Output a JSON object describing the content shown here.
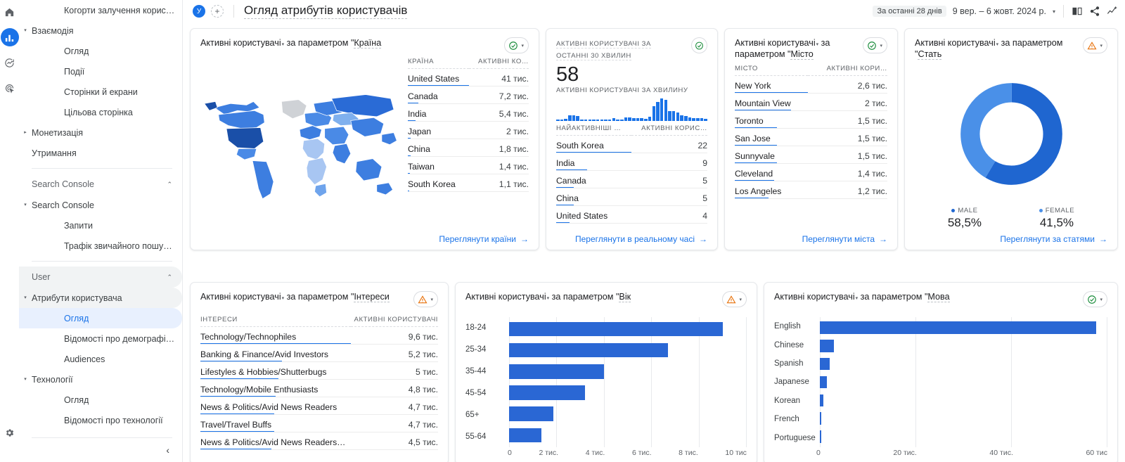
{
  "rail": {
    "items": [
      {
        "name": "home-icon",
        "label": "Home",
        "active": false
      },
      {
        "name": "reports-icon",
        "label": "Reports",
        "active": true
      },
      {
        "name": "explore-icon",
        "label": "Explore",
        "active": false
      },
      {
        "name": "advertising-icon",
        "label": "Advertising",
        "active": false
      }
    ],
    "settings_label": "Admin"
  },
  "sidebar": {
    "items": [
      {
        "label": "Когорти залучення корис…",
        "indent": 2,
        "arrow": "",
        "state": "normal"
      },
      {
        "label": "Взаємодія",
        "indent": 1,
        "arrow": "▾",
        "state": "normal"
      },
      {
        "label": "Огляд",
        "indent": 2,
        "arrow": "",
        "state": "normal"
      },
      {
        "label": "Події",
        "indent": 2,
        "arrow": "",
        "state": "normal"
      },
      {
        "label": "Сторінки й екрани",
        "indent": 2,
        "arrow": "",
        "state": "normal"
      },
      {
        "label": "Цільова сторінка",
        "indent": 2,
        "arrow": "",
        "state": "normal"
      },
      {
        "label": "Монетизація",
        "indent": 1,
        "arrow": "▸",
        "state": "normal"
      },
      {
        "label": "Утримання",
        "indent": 1,
        "arrow": "",
        "state": "normal"
      }
    ],
    "section_search_console": {
      "label": "Search Console",
      "chevron": "⌃"
    },
    "items2": [
      {
        "label": "Search Console",
        "indent": 1,
        "arrow": "▾",
        "state": "normal"
      },
      {
        "label": "Запити",
        "indent": 2,
        "arrow": "",
        "state": "normal"
      },
      {
        "label": "Трафік звичайного пошук…",
        "indent": 2,
        "arrow": "",
        "state": "normal"
      }
    ],
    "section_user": {
      "label": "User",
      "chevron": "⌃"
    },
    "items3": [
      {
        "label": "Атрибути користувача",
        "indent": 1,
        "arrow": "▾",
        "state": "group"
      },
      {
        "label": "Огляд",
        "indent": 2,
        "arrow": "",
        "state": "selected"
      },
      {
        "label": "Відомості про демографіч…",
        "indent": 2,
        "arrow": "",
        "state": "normal"
      },
      {
        "label": "Audiences",
        "indent": 2,
        "arrow": "",
        "state": "normal"
      },
      {
        "label": "Технології",
        "indent": 1,
        "arrow": "▾",
        "state": "normal"
      },
      {
        "label": "Огляд",
        "indent": 2,
        "arrow": "",
        "state": "normal"
      },
      {
        "label": "Відомості про технології",
        "indent": 2,
        "arrow": "",
        "state": "normal"
      }
    ],
    "collapse_icon": "‹"
  },
  "topbar": {
    "avatar_letter": "У",
    "add_label": "+",
    "page_title": "Огляд атрибутів користувачів",
    "date_chip": "За останні 28 днів",
    "date_range": "9 вер. – 6 жовт. 2024 р.",
    "caret": "▾",
    "icons": [
      {
        "name": "compare-icon",
        "label": "Порівняти"
      },
      {
        "name": "share-icon",
        "label": "Поділитися"
      },
      {
        "name": "insights-icon",
        "label": "Статистика"
      }
    ]
  },
  "cards": {
    "country": {
      "title_metric": "Активні користувачі",
      "title_mid": " за параметром \"",
      "title_dim": "Країна",
      "status": "ok",
      "columns": [
        "КРАЇНА",
        "АКТИВНІ КО…"
      ],
      "rows": [
        {
          "label": "United States",
          "value": "41 тис.",
          "pct": 100
        },
        {
          "label": "Canada",
          "value": "7,2 тис.",
          "pct": 17.5
        },
        {
          "label": "India",
          "value": "5,4 тис.",
          "pct": 13.2
        },
        {
          "label": "Japan",
          "value": "2 тис.",
          "pct": 4.9
        },
        {
          "label": "China",
          "value": "1,8 тис.",
          "pct": 4.4
        },
        {
          "label": "Taiwan",
          "value": "1,4 тис.",
          "pct": 3.4
        },
        {
          "label": "South Korea",
          "value": "1,1 тис.",
          "pct": 2.7
        }
      ],
      "link": "Переглянути країни"
    },
    "realtime": {
      "header": "АКТИВНІ КОРИСТУВАЧІ ЗА ОСТАННІ 30 ХВИЛИН",
      "status": "ok",
      "big_value": "58",
      "sub_label": "АКТИВНІ КОРИСТУВАЧІ ЗА ХВИЛИНУ",
      "sparkline": [
        4,
        4,
        10,
        26,
        26,
        22,
        5,
        4,
        4,
        3,
        3,
        4,
        4,
        8,
        14,
        5,
        5,
        16,
        16,
        14,
        13,
        12,
        11,
        20,
        66,
        86,
        100,
        95,
        45,
        44,
        38,
        24,
        22,
        17,
        14,
        13,
        12,
        10
      ],
      "columns": [
        "НАЙАКТИВНІШІ …",
        "АКТИВНІ КОРИС…"
      ],
      "rows": [
        {
          "label": "South Korea",
          "value": "22",
          "pct": 100
        },
        {
          "label": "India",
          "value": "9",
          "pct": 41
        },
        {
          "label": "Canada",
          "value": "5",
          "pct": 23
        },
        {
          "label": "China",
          "value": "5",
          "pct": 23
        },
        {
          "label": "United States",
          "value": "4",
          "pct": 18
        }
      ],
      "link": "Переглянути в реальному часі"
    },
    "city": {
      "title_metric": "Активні користувачі",
      "title_mid": " за параметром \"",
      "title_dim": "Місто",
      "status": "ok",
      "columns": [
        "МІСТО",
        "АКТИВНІ КОРИ…"
      ],
      "rows": [
        {
          "label": "New York",
          "value": "2,6 тис.",
          "pct": 100
        },
        {
          "label": "Mountain View",
          "value": "2 тис.",
          "pct": 77
        },
        {
          "label": "Toronto",
          "value": "1,5 тис.",
          "pct": 58
        },
        {
          "label": "San Jose",
          "value": "1,5 тис.",
          "pct": 58
        },
        {
          "label": "Sunnyvale",
          "value": "1,5 тис.",
          "pct": 58
        },
        {
          "label": "Cleveland",
          "value": "1,4 тис.",
          "pct": 54
        },
        {
          "label": "Los Angeles",
          "value": "1,2 тис.",
          "pct": 46
        }
      ],
      "link": "Переглянути міста"
    },
    "gender": {
      "title_metric": "Активні користувачі",
      "title_mid": " за параметром \"",
      "title_dim": "Стать",
      "status": "warn",
      "link": "Переглянути за статями"
    },
    "interests": {
      "title_metric": "Активні користувачі",
      "title_mid": " за параметром \"",
      "title_dim": "Інтереси",
      "status": "warn",
      "columns": [
        "ІНТЕРЕСИ",
        "АКТИВНІ КОРИСТУВАЧІ"
      ],
      "rows": [
        {
          "label": "Technology/Technophiles",
          "value": "9,6 тис.",
          "pct": 100
        },
        {
          "label": "Banking & Finance/Avid Investors",
          "value": "5,2 тис.",
          "pct": 54
        },
        {
          "label": "Lifestyles & Hobbies/Shutterbugs",
          "value": "5 тис.",
          "pct": 52
        },
        {
          "label": "Technology/Mobile Enthusiasts",
          "value": "4,8 тис.",
          "pct": 50
        },
        {
          "label": "News & Politics/Avid News Readers",
          "value": "4,7 тис.",
          "pct": 49
        },
        {
          "label": "Travel/Travel Buffs",
          "value": "4,7 тис.",
          "pct": 49
        },
        {
          "label": "News & Politics/Avid News Readers…",
          "value": "4,5 тис.",
          "pct": 47
        }
      ]
    }
  },
  "chart_data": [
    {
      "type": "bar",
      "orientation": "horizontal",
      "title": "Активні користувачі за параметром \"Вік\"",
      "card_key": "age",
      "status": "warn",
      "categories": [
        "18-24",
        "25-34",
        "35-44",
        "45-54",
        "65+",
        "55-64"
      ],
      "values": [
        9000,
        6700,
        4000,
        3200,
        1850,
        1350
      ],
      "ticks": [
        "0",
        "2 тис.",
        "4 тис.",
        "6 тис.",
        "8 тис.",
        "10 тис"
      ],
      "xlim": [
        0,
        10000
      ],
      "xlabel": "",
      "ylabel": "",
      "grid": true,
      "color": "#2a67d4"
    },
    {
      "type": "bar",
      "orientation": "horizontal",
      "title": "Активні користувачі за параметром \"Мова\"",
      "card_key": "language",
      "status": "ok",
      "categories": [
        "English",
        "Chinese",
        "Spanish",
        "Japanese",
        "Korean",
        "French",
        "Portuguese"
      ],
      "values": [
        59500,
        3000,
        2100,
        1500,
        800,
        400,
        350
      ],
      "ticks": [
        "0",
        "20 тис.",
        "40 тис.",
        "60 тис"
      ],
      "xlim": [
        0,
        62000
      ],
      "xlabel": "",
      "ylabel": "",
      "grid": true,
      "color": "#2a67d4"
    }
  ],
  "gender_chart": {
    "type": "pie",
    "title": "Активні користувачі за параметром \"Стать\"",
    "labels": [
      "MALE",
      "FEMALE"
    ],
    "values": [
      58.5,
      41.5
    ],
    "display_values": [
      "58,5%",
      "41,5%"
    ],
    "colors": [
      "#1f66d0",
      "#4a90e8"
    ],
    "donut": true
  },
  "colors": {
    "accent": "#1a73e8",
    "bar": "#2a67d4",
    "ok": "#1e8e3e",
    "warn": "#e8710a",
    "text": "#202124",
    "muted": "#5f6368",
    "border": "#e6e8eb"
  }
}
